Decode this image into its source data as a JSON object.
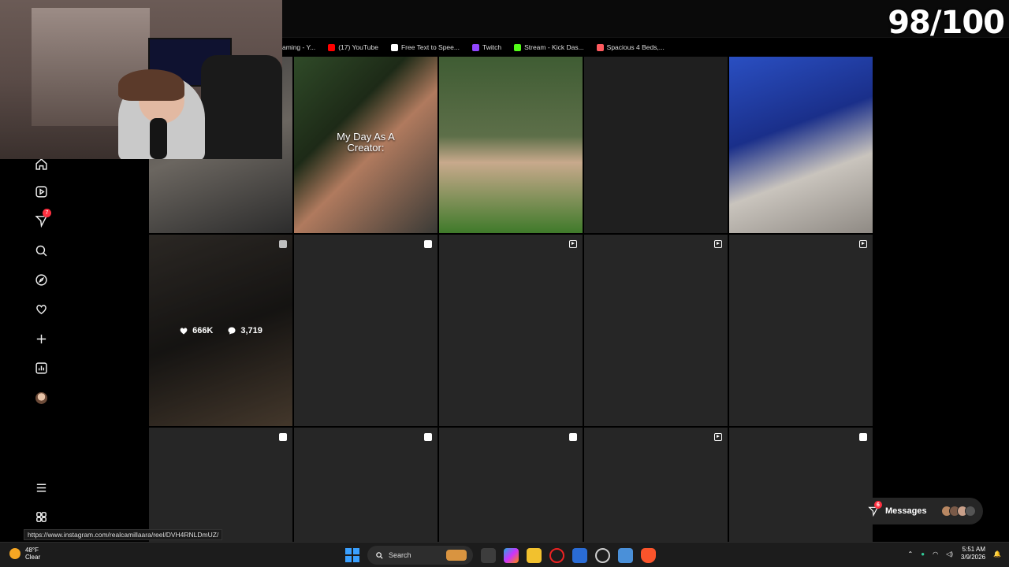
{
  "overlay": {
    "score": "98/100"
  },
  "bookmarks": [
    {
      "label": "aming - Y...",
      "color": "#ffffff"
    },
    {
      "label": "(17) YouTube",
      "color": "#ff0000"
    },
    {
      "label": "Free Text to Spee...",
      "color": "#ffffff"
    },
    {
      "label": "Twitch",
      "color": "#9146ff"
    },
    {
      "label": "Stream - Kick Das...",
      "color": "#53fc18"
    },
    {
      "label": "Spacious 4 Beds,...",
      "color": "#ff5a5f"
    }
  ],
  "sidebar": {
    "items": [
      {
        "icon": "home-icon"
      },
      {
        "icon": "reels-icon"
      },
      {
        "icon": "messages-icon",
        "badge": "7"
      },
      {
        "icon": "search-icon"
      },
      {
        "icon": "explore-icon"
      },
      {
        "icon": "notifications-heart-icon"
      },
      {
        "icon": "create-plus-icon"
      },
      {
        "icon": "dashboard-icon"
      },
      {
        "icon": "profile-avatar"
      }
    ],
    "more": {
      "icon": "menu-icon"
    },
    "also_from": {
      "icon": "apps-icon"
    }
  },
  "grid": {
    "hovered_post": {
      "likes": "666K",
      "comments": "3,719"
    },
    "caption_post": {
      "caption_line1": "My Day As A",
      "caption_line2": "Creator:"
    }
  },
  "messages": {
    "label": "Messages",
    "badge": "6"
  },
  "status_url": "https://www.instagram.com/realcamillaara/reel/DVH4RNLDmUZ/",
  "taskbar": {
    "weather_temp": "48°F",
    "weather_desc": "Clear",
    "search_label": "Search",
    "time": "5:51 AM",
    "date": "3/9/2026"
  }
}
